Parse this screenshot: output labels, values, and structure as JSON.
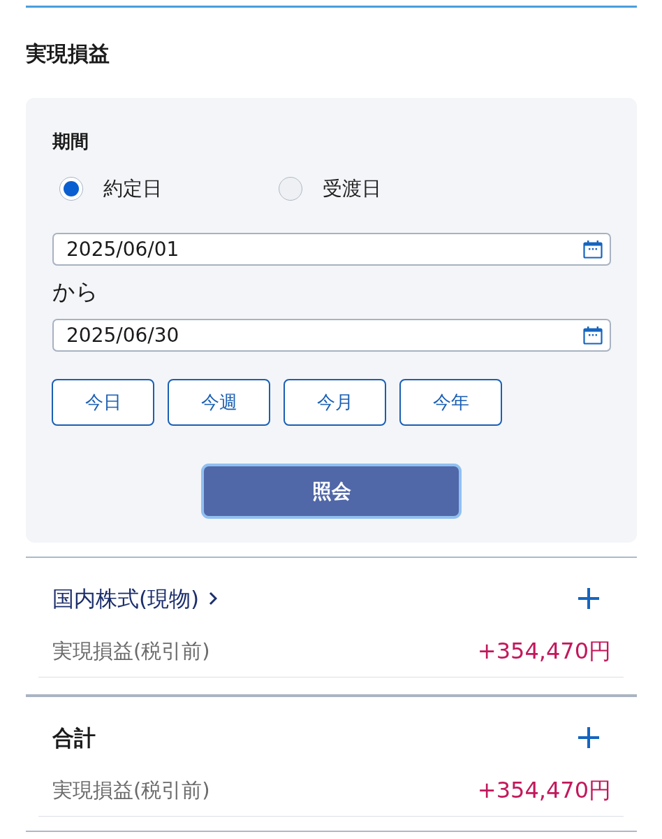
{
  "title": "実現損益",
  "period": {
    "label": "期間",
    "options": [
      {
        "label": "約定日",
        "selected": true
      },
      {
        "label": "受渡日",
        "selected": false
      }
    ],
    "from": {
      "value": "2025/06/01"
    },
    "separator": "から",
    "to": {
      "value": "2025/06/30"
    },
    "presets": [
      "今日",
      "今週",
      "今月",
      "今年"
    ],
    "submit": "照会"
  },
  "sections": [
    {
      "kind": "link",
      "title": "国内株式(現物)",
      "expanded": false,
      "rows": [
        {
          "label": "実現損益(税引前)",
          "value": "+354,470円"
        }
      ]
    },
    {
      "kind": "total",
      "title": "合計",
      "expanded": false,
      "rows": [
        {
          "label": "実現損益(税引前)",
          "value": "+354,470円"
        }
      ]
    }
  ]
}
